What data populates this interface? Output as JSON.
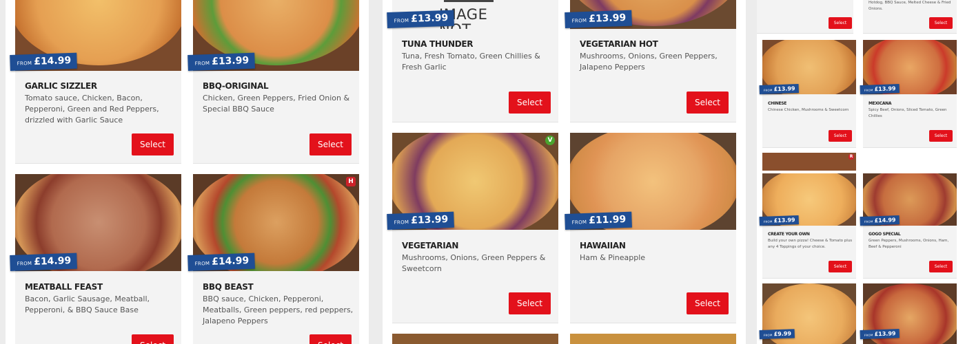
{
  "menu": {
    "price_prefix": "FROM",
    "select_label": "Select",
    "image_not_available": "IMAGE NOT AVAILABLE",
    "colors": {
      "price_tag": "#1f4e94",
      "select_button": "#e3111b",
      "veg_badge": "#4aa52f",
      "hot_badge": "#cc2229"
    },
    "badges": {
      "veg": "V",
      "hot": "H",
      "r": "R"
    },
    "left": [
      {
        "title": "GARLIC SIZZLER",
        "price": "£14.99",
        "desc": "Tomato sauce, Chicken, Bacon, Pepperoni, Green and Red Peppers, drizzled with Garlic Sauce"
      },
      {
        "title": "BBQ-ORIGINAL",
        "price": "£13.99",
        "desc": "Chicken, Green Peppers, Fried Onion & Special BBQ Sauce"
      },
      {
        "title": "MEATBALL FEAST",
        "price": "£14.99",
        "desc": "Bacon, Garlic Sausage, Meatball, Pepperoni, & BBQ Sauce Base"
      },
      {
        "title": "BBQ BEAST",
        "price": "£14.99",
        "desc": "BBQ sauce, Chicken, Pepperoni, Meatballs, Green peppers, red peppers, Jalapeno Peppers"
      }
    ],
    "middle": [
      {
        "title": "TUNA THUNDER",
        "price": "£13.99",
        "desc": "Tuna, Fresh Tomato, Green Chillies & Fresh Garlic"
      },
      {
        "title": "VEGETARIAN HOT",
        "price": "£13.99",
        "desc": "Mushrooms, Onions, Green Peppers, Jalapeno Peppers"
      },
      {
        "title": "VEGETARIAN",
        "price": "£13.99",
        "desc": "Mushrooms, Onions, Green Peppers & Sweetcorn"
      },
      {
        "title": "HAWAIIAN",
        "price": "£11.99",
        "desc": "Ham & Pineapple"
      }
    ],
    "right": {
      "top_desc": "Hotdog, BBQ Sauce, Melted Cheese & Fried Onions.",
      "items": [
        {
          "title": "CHINESE",
          "price": "£13.99",
          "desc": "Chinese Chicken, Mushrooms & Sweetcorn"
        },
        {
          "title": "MEXICANA",
          "price": "£13.99",
          "desc": "Spicy Beef, Onions, Sliced Tomato, Green Chillies"
        },
        {
          "title": "CREATE YOUR OWN",
          "price": "£13.99",
          "desc": "Build your own pizza! Cheese & Tomato plus any 4 Toppings of your choice."
        },
        {
          "title": "GOGO SPECIAL",
          "price": "£14.99",
          "desc": "Green Peppers, Mushrooms, Onions, Ham, Beef & Pepperoni"
        },
        {
          "price": "£9.99"
        },
        {
          "price": "£13.99"
        }
      ]
    }
  }
}
